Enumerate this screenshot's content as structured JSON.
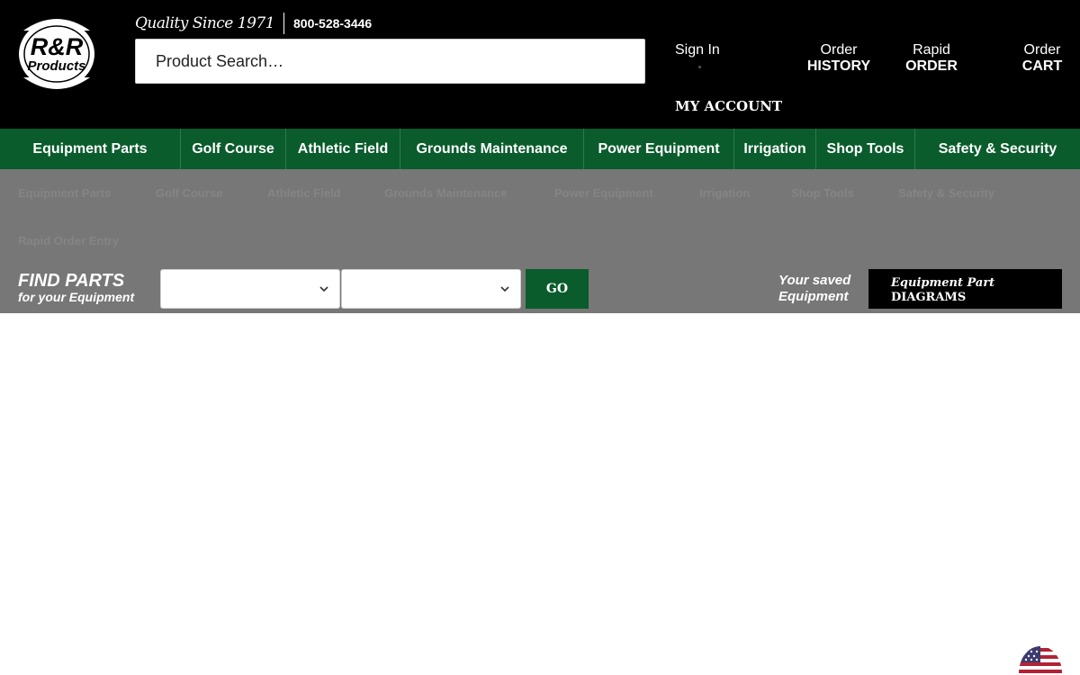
{
  "header": {
    "logo_text_top": "R&R",
    "logo_text_bottom": "Products",
    "tagline": "Quality Since 1971",
    "phone": "800-528-3446",
    "search": {
      "placeholder": "Product Search…"
    },
    "sign_in": "Sign In",
    "my_account": "MY ACCOUNT",
    "order_history": {
      "line1": "Order",
      "line2": "HISTORY"
    },
    "rapid_order": {
      "line1": "Rapid",
      "line2": "ORDER"
    },
    "order_cart": {
      "line1": "Order",
      "line2": "CART"
    }
  },
  "nav": {
    "items": [
      "Equipment Parts",
      "Golf Course",
      "Athletic Field",
      "Grounds Maintenance",
      "Power Equipment",
      "Irrigation",
      "Shop Tools",
      "Safety & Security"
    ]
  },
  "submenu": {
    "items": [
      "Equipment Parts",
      "Golf Course",
      "Athletic Field",
      "Grounds Maintenance",
      "Power Equipment",
      "Irrigation",
      "Shop Tools",
      "Safety & Security",
      "Rapid Order Entry"
    ]
  },
  "find_parts": {
    "title": "FIND PARTS",
    "subtitle": "for your Equipment",
    "select1_value": "",
    "select2_value": "",
    "go_label": "GO",
    "saved_line1": "Your saved",
    "saved_line2": "Equipment",
    "diagrams_line1": "Equipment Part",
    "diagrams_line2": "DIAGRAMS"
  },
  "colors": {
    "header_bg": "#000000",
    "nav_bg": "#0a5c2c",
    "band_bg": "#777777",
    "accent_green": "#0a5c2c"
  },
  "icons": {
    "chevron": "chevron-down-icon",
    "flag": "us-flag-icon"
  }
}
